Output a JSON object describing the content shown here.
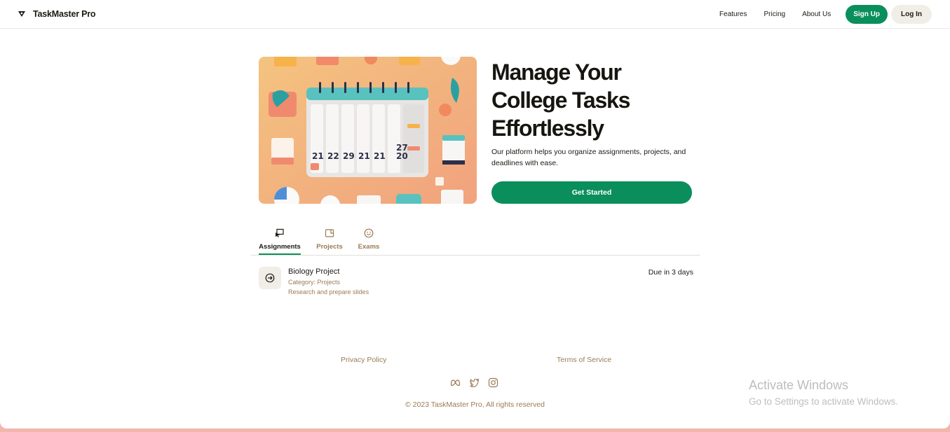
{
  "header": {
    "brand": "TaskMaster Pro",
    "nav": [
      "Features",
      "Pricing",
      "About Us"
    ],
    "signup_label": "Sign Up",
    "login_label": "Log In"
  },
  "hero": {
    "title": "Manage Your College Tasks Effortlessly",
    "subtitle": "Our platform helps you organize assignments, projects, and deadlines with ease.",
    "cta_label": "Get Started"
  },
  "tabs": [
    {
      "label": "Assignments",
      "icon": "cursor-icon",
      "active": true
    },
    {
      "label": "Projects",
      "icon": "folder-icon",
      "active": false
    },
    {
      "label": "Exams",
      "icon": "smiley-icon",
      "active": false
    }
  ],
  "task": {
    "title": "Biology Project",
    "category": "Category: Projects",
    "description": "Research and prepare slides",
    "due": "Due in 3 days",
    "icon": "arrow-circle-icon"
  },
  "footer": {
    "privacy": "Privacy Policy",
    "terms": "Terms of Service",
    "social": [
      "meta-icon",
      "twitter-icon",
      "instagram-icon"
    ],
    "copyright": "© 2023 TaskMaster Pro, All rights reserved"
  },
  "watermark": {
    "title": "Activate Windows",
    "subtitle": "Go to Settings to activate Windows."
  },
  "colors": {
    "accent": "#0a8f5c",
    "muted_text": "#9a7b55",
    "button_light": "#f1eee8"
  }
}
